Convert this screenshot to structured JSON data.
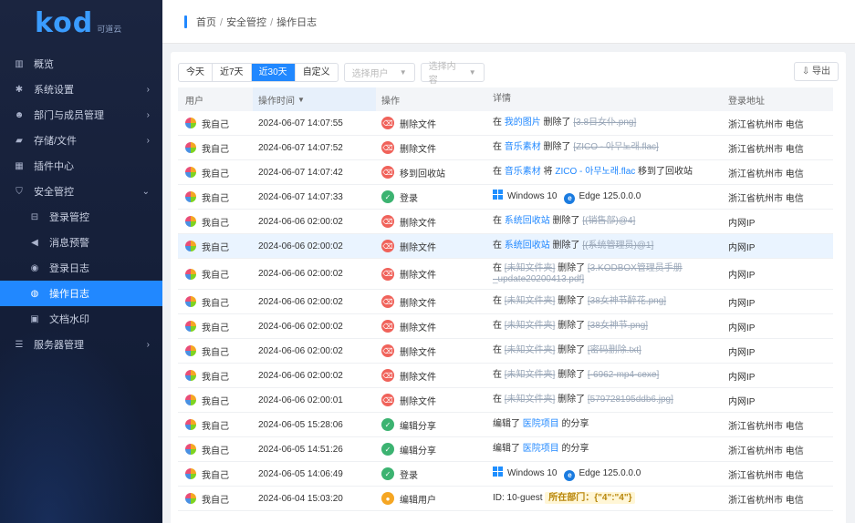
{
  "brand": {
    "logo": "kod",
    "sub": "可道云"
  },
  "sidebar": {
    "items": [
      {
        "label": "概览",
        "icon": "bar-chart-icon",
        "glyph": "▥",
        "arrow": ""
      },
      {
        "label": "系统设置",
        "icon": "gear-icon",
        "glyph": "✱",
        "arrow": "›"
      },
      {
        "label": "部门与成员管理",
        "icon": "users-icon",
        "glyph": "☻",
        "arrow": "›"
      },
      {
        "label": "存储/文件",
        "icon": "folder-icon",
        "glyph": "▰",
        "arrow": "›"
      },
      {
        "label": "插件中心",
        "icon": "apps-icon",
        "glyph": "▦",
        "arrow": ""
      },
      {
        "label": "安全管控",
        "icon": "shield-icon",
        "glyph": "⛉",
        "arrow": "⌄"
      }
    ],
    "subitems": [
      {
        "label": "登录管控",
        "icon": "login-icon",
        "glyph": "⊟"
      },
      {
        "label": "消息预警",
        "icon": "bell-icon",
        "glyph": "◀"
      },
      {
        "label": "登录日志",
        "icon": "log-icon",
        "glyph": "◉"
      },
      {
        "label": "操作日志",
        "icon": "operation-icon",
        "glyph": "◍"
      },
      {
        "label": "文档水印",
        "icon": "watermark-icon",
        "glyph": "▣"
      }
    ],
    "last": {
      "label": "服务器管理",
      "icon": "server-icon",
      "glyph": "☰",
      "arrow": "›"
    }
  },
  "breadcrumb": {
    "home": "首页",
    "sec": "安全管控",
    "page": "操作日志"
  },
  "toolbar": {
    "ranges": [
      "今天",
      "近7天",
      "近30天",
      "自定义"
    ],
    "user_placeholder": "选择用户",
    "content_placeholder": "选择内容",
    "export": "导出"
  },
  "table": {
    "headers": {
      "user": "用户",
      "time": "操作时间",
      "op": "操作",
      "detail": "详情",
      "loc": "登录地址"
    },
    "rows": [
      {
        "user": "我自己",
        "time": "2024-06-07 14:07:55",
        "op": "删除文件",
        "type": "red",
        "d": [
          [
            "t",
            "在 "
          ],
          [
            "l",
            "我的图片"
          ],
          [
            "t",
            " 删除了 "
          ],
          [
            "s",
            "[3.8日女仆.png]"
          ]
        ],
        "loc": "浙江省杭州市 电信",
        "h": 27
      },
      {
        "user": "我自己",
        "time": "2024-06-07 14:07:52",
        "op": "删除文件",
        "type": "red",
        "d": [
          [
            "t",
            "在 "
          ],
          [
            "l",
            "音乐素材"
          ],
          [
            "t",
            " 删除了 "
          ],
          [
            "s",
            "[ZICO - 아무노래.flac]"
          ]
        ],
        "loc": "浙江省杭州市 电信",
        "h": 27
      },
      {
        "user": "我自己",
        "time": "2024-06-07 14:07:42",
        "op": "移到回收站",
        "type": "red",
        "d": [
          [
            "t",
            "在 "
          ],
          [
            "l",
            "音乐素材"
          ],
          [
            "t",
            " 将 "
          ],
          [
            "l",
            "ZICO - 아무노래.flac"
          ],
          [
            "t",
            " 移到了回收站"
          ]
        ],
        "loc": "浙江省杭州市 电信",
        "h": 27
      },
      {
        "user": "我自己",
        "time": "2024-06-07 14:07:33",
        "op": "登录",
        "type": "green",
        "d": [
          [
            "w",
            "Windows 10"
          ],
          [
            "e",
            "Edge 125.0.0.0"
          ]
        ],
        "loc": "浙江省杭州市 电信",
        "h": 27
      },
      {
        "user": "我自己",
        "time": "2024-06-06 02:00:02",
        "op": "删除文件",
        "type": "red",
        "d": [
          [
            "t",
            "在 "
          ],
          [
            "l",
            "系统回收站"
          ],
          [
            "t",
            " 删除了 "
          ],
          [
            "s",
            "[(销售部)@4]"
          ]
        ],
        "loc": "内网IP",
        "h": 27
      },
      {
        "user": "我自己",
        "time": "2024-06-06 02:00:02",
        "op": "删除文件",
        "type": "red",
        "d": [
          [
            "t",
            "在 "
          ],
          [
            "l",
            "系统回收站"
          ],
          [
            "t",
            " 删除了 "
          ],
          [
            "s",
            "[(系统管理员)@1]"
          ]
        ],
        "loc": "内网IP",
        "h": 27,
        "hl": true
      },
      {
        "user": "我自己",
        "time": "2024-06-06 02:00:02",
        "op": "删除文件",
        "type": "red",
        "d": [
          [
            "t",
            "在 "
          ],
          [
            "s",
            "[未知文件夹]"
          ],
          [
            "t",
            " 删除了 "
          ],
          [
            "s",
            "[3.KODBOX管理员手册_update20200413.pdf]"
          ]
        ],
        "loc": "内网IP",
        "h": 34
      },
      {
        "user": "我自己",
        "time": "2024-06-06 02:00:02",
        "op": "删除文件",
        "type": "red",
        "d": [
          [
            "t",
            "在 "
          ],
          [
            "s",
            "[未知文件夹]"
          ],
          [
            "t",
            " 删除了 "
          ],
          [
            "s",
            "[38女神节醉花.png]"
          ]
        ],
        "loc": "内网IP",
        "h": 27
      },
      {
        "user": "我自己",
        "time": "2024-06-06 02:00:02",
        "op": "删除文件",
        "type": "red",
        "d": [
          [
            "t",
            "在 "
          ],
          [
            "s",
            "[未知文件夹]"
          ],
          [
            "t",
            " 删除了 "
          ],
          [
            "s",
            "[38女神节.png]"
          ]
        ],
        "loc": "内网IP",
        "h": 27
      },
      {
        "user": "我自己",
        "time": "2024-06-06 02:00:02",
        "op": "删除文件",
        "type": "red",
        "d": [
          [
            "t",
            "在 "
          ],
          [
            "s",
            "[未知文件夹]"
          ],
          [
            "t",
            " 删除了 "
          ],
          [
            "s",
            "[密码删除.txt]"
          ]
        ],
        "loc": "内网IP",
        "h": 27
      },
      {
        "user": "我自己",
        "time": "2024-06-06 02:00:02",
        "op": "删除文件",
        "type": "red",
        "d": [
          [
            "t",
            "在 "
          ],
          [
            "s",
            "[未知文件夹]"
          ],
          [
            "t",
            " 删除了 "
          ],
          [
            "s",
            "[-6962-mp4-cexe]"
          ]
        ],
        "loc": "内网IP",
        "h": 27
      },
      {
        "user": "我自己",
        "time": "2024-06-06 02:00:01",
        "op": "删除文件",
        "type": "red",
        "d": [
          [
            "t",
            "在 "
          ],
          [
            "s",
            "[未知文件夹]"
          ],
          [
            "t",
            " 删除了 "
          ],
          [
            "s",
            "[579728195ddb6.jpg]"
          ]
        ],
        "loc": "内网IP",
        "h": 27
      },
      {
        "user": "我自己",
        "time": "2024-06-05 15:28:06",
        "op": "编辑分享",
        "type": "green",
        "d": [
          [
            "t",
            "编辑了 "
          ],
          [
            "l",
            "医院项目"
          ],
          [
            "t",
            " 的分享"
          ]
        ],
        "loc": "浙江省杭州市 电信",
        "h": 27
      },
      {
        "user": "我自己",
        "time": "2024-06-05 14:51:26",
        "op": "编辑分享",
        "type": "green",
        "d": [
          [
            "t",
            "编辑了 "
          ],
          [
            "l",
            "医院项目"
          ],
          [
            "t",
            " 的分享"
          ]
        ],
        "loc": "浙江省杭州市 电信",
        "h": 27
      },
      {
        "user": "我自己",
        "time": "2024-06-05 14:06:49",
        "op": "登录",
        "type": "green",
        "d": [
          [
            "w",
            "Windows 10"
          ],
          [
            "e",
            "Edge 125.0.0.0"
          ]
        ],
        "loc": "浙江省杭州市 电信",
        "h": 27
      },
      {
        "user": "我自己",
        "time": "2024-06-04 15:03:20",
        "op": "编辑用户",
        "type": "orange",
        "d": [
          [
            "t",
            "ID: 10-guest  "
          ],
          [
            "g",
            "所在部门：{\"4\":\"4\"}"
          ]
        ],
        "loc": "浙江省杭州市 电信",
        "h": 27
      }
    ]
  }
}
